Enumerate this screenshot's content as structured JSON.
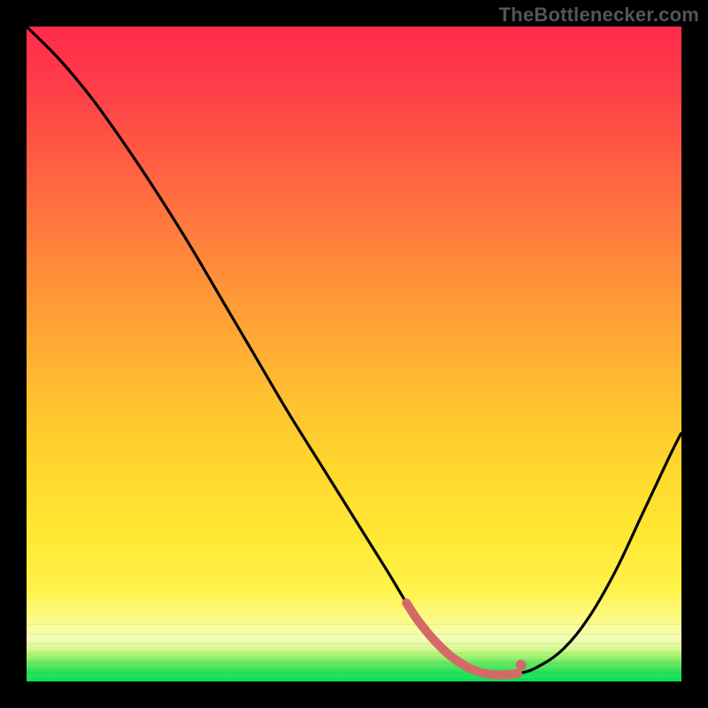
{
  "watermark": "TheBottlenecker.com",
  "chart_data": {
    "type": "line",
    "title": "",
    "xlabel": "",
    "ylabel": "",
    "xlim": [
      0,
      100
    ],
    "ylim": [
      0,
      100
    ],
    "gradient": {
      "top_color": "#ff2b4c",
      "mid_color": "#ffe438",
      "bottom_color": "#07e25a"
    },
    "series": [
      {
        "name": "curve",
        "x": [
          0,
          5,
          10,
          15,
          20,
          25,
          30,
          35,
          40,
          45,
          50,
          55,
          58,
          60,
          63,
          66,
          69,
          72,
          75,
          78,
          82,
          86,
          90,
          94,
          98,
          100
        ],
        "y": [
          100,
          95,
          89,
          82,
          74.5,
          66.5,
          58,
          49.5,
          41,
          33,
          25,
          17,
          12,
          9,
          5.5,
          3,
          1.5,
          1,
          1.2,
          2.2,
          5,
          10,
          17,
          25.5,
          34,
          38
        ]
      }
    ],
    "highlight_band": {
      "x": [
        58,
        75
      ],
      "y_approx": 1.5,
      "color": "#d46a67"
    },
    "highlight_dot": {
      "x": 75.5,
      "y": 2.5,
      "color": "#d46a67"
    }
  }
}
